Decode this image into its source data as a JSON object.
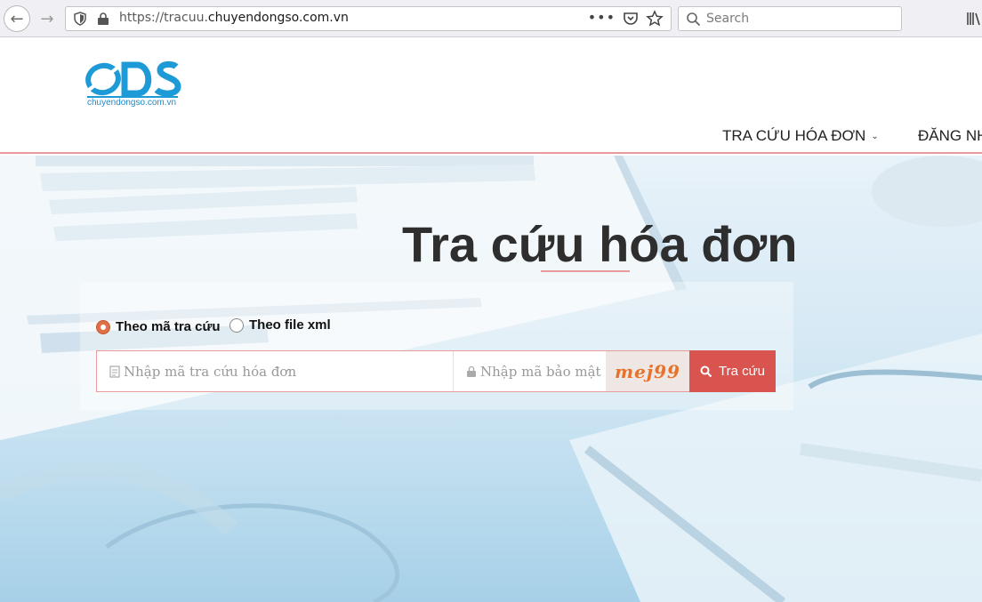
{
  "browser": {
    "url_prefix": "https://tracuu.",
    "url_host": "chuyendongso.com.vn",
    "more_label": "•••",
    "search_placeholder": "Search"
  },
  "header": {
    "logo_text": "chuyendongso.com.vn",
    "menu": [
      {
        "label": "TRA CỨU HÓA ĐƠN",
        "has_dropdown": true
      },
      {
        "label": "ĐĂNG NH"
      }
    ]
  },
  "hero": {
    "title": "Tra cứu hóa đơn",
    "radio_options": [
      {
        "label": "Theo mã tra cứu",
        "checked": true
      },
      {
        "label": "Theo file xml",
        "checked": false
      }
    ],
    "code_placeholder": "Nhập mã tra cứu hóa đơn",
    "security_placeholder": "Nhập mã bảo mật",
    "captcha": "mej99",
    "submit_label": "Tra cứu"
  },
  "colors": {
    "accent": "#d9534f",
    "logo_blue": "#1e9bd7",
    "underline": "#e99a9a"
  }
}
